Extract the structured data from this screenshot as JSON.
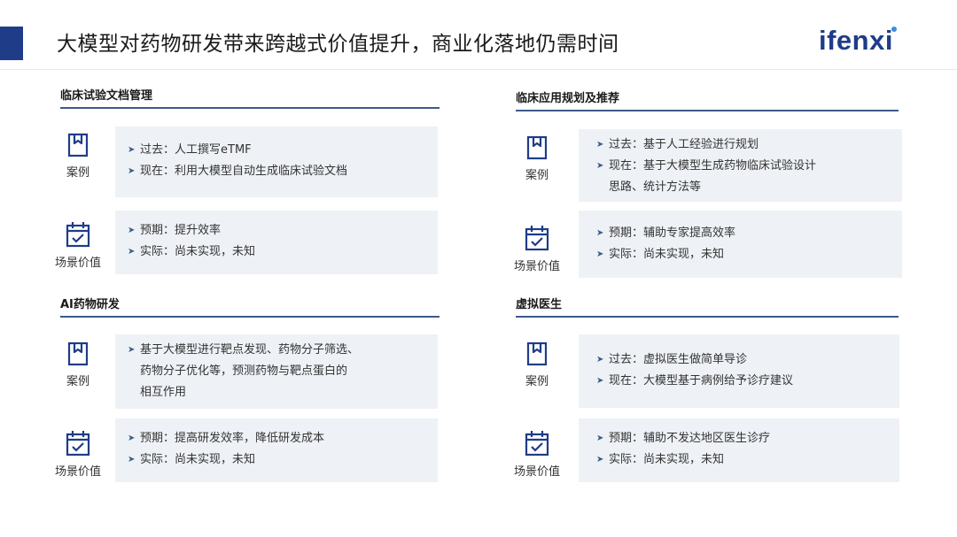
{
  "title": "大模型对药物研发带来跨越式价值提升，商业化落地仍需时间",
  "logo": "ifenxi",
  "sections": [
    {
      "title": "临床试验文档管理",
      "case_label": "案例",
      "value_label": "场景价值",
      "case_bullets": [
        "过去：人工撰写eTMF",
        "现在：利用大模型自动生成临床试验文档"
      ],
      "value_bullets": [
        "预期：提升效率",
        "实际：尚未实现，未知"
      ]
    },
    {
      "title": "临床应用规划及推荐",
      "case_label": "案例",
      "value_label": "场景价值",
      "case_bullets": [
        "过去：基于人工经验进行规划",
        "现在：基于大模型生成药物临床试验设计\n思路、统计方法等"
      ],
      "value_bullets": [
        "预期：辅助专家提高效率",
        "实际：尚未实现，未知"
      ]
    },
    {
      "title": "AI药物研发",
      "case_label": "案例",
      "value_label": "场景价值",
      "case_bullets": [
        "基于大模型进行靶点发现、药物分子筛选、\n药物分子优化等，预测药物与靶点蛋白的\n相互作用"
      ],
      "value_bullets": [
        "预期：提高研发效率，降低研发成本",
        "实际：尚未实现，未知"
      ]
    },
    {
      "title": "虚拟医生",
      "case_label": "案例",
      "value_label": "场景价值",
      "case_bullets": [
        "过去：虚拟医生做简单导诊",
        "现在：大模型基于病例给予诊疗建议"
      ],
      "value_bullets": [
        "预期：辅助不发达地区医生诊疗",
        "实际：尚未实现，未知"
      ]
    }
  ],
  "colors": {
    "accent": "#1f3c88",
    "box_bg": "#eef1f6",
    "rule": "#3c5a8a"
  },
  "icons": {
    "case": "bookmark-icon",
    "value": "calendar-check-icon",
    "bullet": "arrow-bullet-icon"
  }
}
